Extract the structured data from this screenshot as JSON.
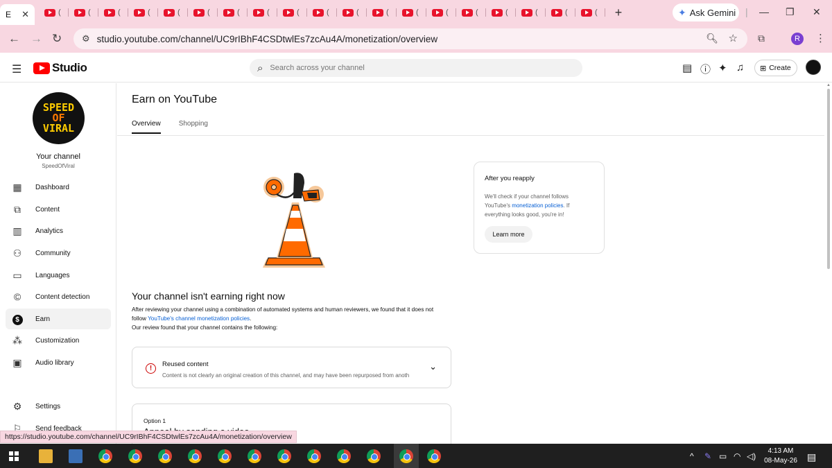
{
  "browser": {
    "active_tab_label": "E",
    "tab_count_youtube": 19,
    "tab_glyph": "(",
    "new_tab": "+",
    "ask_gemini": "Ask Gemini",
    "url": "studio.youtube.com/channel/UC9rIBhF4CSDtwlEs7zcAu4A/monetization/overview",
    "profile_initial": "R",
    "status_url": "https://studio.youtube.com/channel/UC9rIBhF4CSDtwlEs7zcAu4A/monetization/overview"
  },
  "header": {
    "logo_text": "Studio",
    "search_placeholder": "Search across your channel",
    "create_label": "Create"
  },
  "sidebar": {
    "avatar_lines": [
      "SPEED",
      "OF",
      "VIRAL"
    ],
    "channel_title": "Your channel",
    "channel_handle": "SpeedOfViral",
    "items": [
      {
        "label": "Dashboard",
        "icon": "dashboard-icon"
      },
      {
        "label": "Content",
        "icon": "content-icon"
      },
      {
        "label": "Analytics",
        "icon": "analytics-icon"
      },
      {
        "label": "Community",
        "icon": "community-icon"
      },
      {
        "label": "Languages",
        "icon": "languages-icon"
      },
      {
        "label": "Content detection",
        "icon": "copyright-icon"
      },
      {
        "label": "Earn",
        "icon": "dollar-icon"
      },
      {
        "label": "Customization",
        "icon": "magic-wand-icon"
      },
      {
        "label": "Audio library",
        "icon": "audio-library-icon"
      },
      {
        "label": "Settings",
        "icon": "gear-icon"
      },
      {
        "label": "Send feedback",
        "icon": "feedback-icon"
      }
    ]
  },
  "main": {
    "page_title": "Earn on YouTube",
    "tabs": [
      {
        "label": "Overview",
        "selected": true
      },
      {
        "label": "Shopping",
        "selected": false
      }
    ],
    "headline": "Your channel isn't earning right now",
    "body_line1": "After reviewing your channel using a combination of automated systems and human reviewers, we found that it does not",
    "body_line2_prefix": "follow ",
    "body_line2_link": "YouTube's channel monetization policies",
    "body_line2_suffix": ".",
    "body_line3": "Our review found that your channel contains the following:",
    "reused_title": "Reused content",
    "reused_desc": "Content is not clearly an original creation of this channel, and may have been repurposed from anoth",
    "option_label": "Option 1",
    "option_heading": "Appeal by sending a video"
  },
  "reapply": {
    "title": "After you reapply",
    "body_prefix": "We'll check if your channel follows YouTube's ",
    "body_link": "monetization policies",
    "body_suffix": ". If everything looks good, you're in!",
    "button": "Learn more"
  },
  "taskbar": {
    "time": "4:13 AM",
    "date": "08-May-26"
  },
  "colors": {
    "browser_chrome": "#f8d7e1",
    "youtube_red": "#ff0000",
    "link_blue": "#065fd4",
    "cone_orange": "#ff6a00"
  }
}
